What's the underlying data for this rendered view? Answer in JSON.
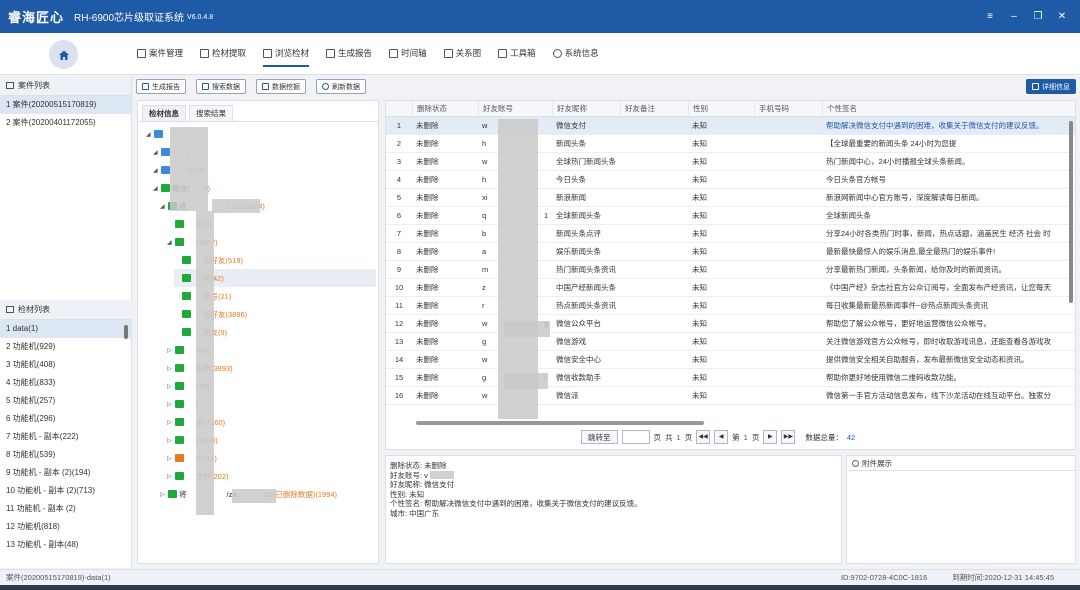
{
  "app": {
    "name": "睿海匠心",
    "title": "RH-6900芯片级取证系统",
    "version": "V6.0.4.8"
  },
  "nav": {
    "items": [
      {
        "label": "案件管理"
      },
      {
        "label": "检材提取"
      },
      {
        "label": "浏览检材"
      },
      {
        "label": "生成报告"
      },
      {
        "label": "时间轴"
      },
      {
        "label": "关系图"
      },
      {
        "label": "工具箱"
      },
      {
        "label": "系统信息"
      }
    ],
    "active": "浏览检材"
  },
  "cases": {
    "title": "案件列表",
    "items": [
      "1  案件(20200515170819)",
      "2  案件(20200401172055)"
    ]
  },
  "detection": {
    "title": "检材列表",
    "items": [
      "1  data(1)",
      "2  功能机(929)",
      "3  功能机(408)",
      "4  功能机(833)",
      "5  功能机(257)",
      "6  功能机(296)",
      "7  功能机 - 副本(222)",
      "8  功能机(539)",
      "9  功能机 - 副本 (2)(194)",
      "10  功能机 - 副本 (2)(713)",
      "11  功能机 - 副本 (2)",
      "12  功能机(818)",
      "13  功能机 - 副本(48)"
    ]
  },
  "toolbar": {
    "buttons": [
      "生成报告",
      "搜索数据",
      "数据挖掘",
      "刷新数据"
    ],
    "detail": "详细信息"
  },
  "tree": {
    "tabs": [
      "检材信息",
      "搜索结果"
    ],
    "rows": [
      {
        "text": "",
        "count": "",
        "indent": 0
      },
      {
        "text": "",
        "count": ")",
        "indent": 1
      },
      {
        "text": "",
        "count": "0018)",
        "indent": 1
      },
      {
        "text": "微信(",
        "count": "8)",
        "indent": 1
      },
      {
        "text": "将",
        "count": "",
        "suffix": "123(18024)",
        "indent": 2
      },
      {
        "text": "",
        "count": "息(1)",
        "indent": 3
      },
      {
        "text": "",
        "count": "(4487)",
        "indent": 3
      },
      {
        "text": "",
        "count": "组好友(519)",
        "indent": 4
      },
      {
        "text": "",
        "count": "号(42)",
        "indent": 4
      },
      {
        "text": "",
        "count": "账号(21)",
        "indent": 4
      },
      {
        "text": "",
        "count": "陌好友(3896)",
        "indent": 4
      },
      {
        "text": "",
        "count": "朋友(9)",
        "indent": 4
      },
      {
        "text": "",
        "count": "(40)",
        "indent": 3
      },
      {
        "text": "",
        "count": "列表(3893)",
        "indent": 3
      },
      {
        "text": "",
        "count": "(40)",
        "indent": 3
      },
      {
        "text": "",
        "count": ")",
        "indent": 3
      },
      {
        "text": "",
        "count": "录(7360)",
        "indent": 3
      },
      {
        "text": "",
        "count": "(1988)",
        "indent": 3
      },
      {
        "text": "",
        "count": "夹(12)",
        "indent": 3
      },
      {
        "text": "",
        "count": "文件(202)",
        "indent": 3
      },
      {
        "text": "将",
        "count": "",
        "suffix": "/za",
        "tail": "23(已删除数据)(1994)",
        "indent": 2
      }
    ]
  },
  "table": {
    "columns": [
      "删除状态",
      "好友账号",
      "好友昵称",
      "好友备注",
      "性别",
      "手机号码",
      "个性签名"
    ],
    "rows": [
      {
        "n": "1",
        "status": "未删除",
        "acct": "w",
        "nick": "微信支付",
        "gender": "未知",
        "sig": "帮助解决微信支付中遇到的困难，收集关于微信支付的建议反馈。"
      },
      {
        "n": "2",
        "status": "未删除",
        "acct": "h",
        "nick": "新闻头条",
        "gender": "未知",
        "sig": "【全球最重要的新闻头条 24小时为您提"
      },
      {
        "n": "3",
        "status": "未删除",
        "acct": "w",
        "nick": "全球热门新闻头条",
        "gender": "未知",
        "sig": "热门新闻中心，24小时播报全球头条新闻。"
      },
      {
        "n": "4",
        "status": "未删除",
        "acct": "h",
        "nick": "今日头条",
        "gender": "未知",
        "sig": "今日头条官方帐号"
      },
      {
        "n": "5",
        "status": "未删除",
        "acct": "xi",
        "nick": "新浪新闻",
        "gender": "未知",
        "sig": "新浪网新闻中心官方账号，深度解读每日新闻。"
      },
      {
        "n": "6",
        "status": "未删除",
        "acct": "q",
        "acct2": "1",
        "nick": "全球新闻头条",
        "gender": "未知",
        "sig": "全球新闻头条"
      },
      {
        "n": "7",
        "status": "未删除",
        "acct": "b",
        "nick": "新闻头条点评",
        "gender": "未知",
        "sig": "分享24小时各类热门时事，新闻，热点话题，涵盖民生 经济 社会 时"
      },
      {
        "n": "8",
        "status": "未删除",
        "acct": "a",
        "nick": "娱乐新闻头条",
        "gender": "未知",
        "sig": "最新最快最惊人的娱乐消息,最全最热门的娱乐事件!"
      },
      {
        "n": "9",
        "status": "未删除",
        "acct": "m",
        "nick": "热门新闻头条资讯",
        "gender": "未知",
        "sig": "分享最新热门新闻，头条新闻，给你及时的新闻资讯。"
      },
      {
        "n": "10",
        "status": "未删除",
        "acct": "z",
        "nick": "中国产经新闻头条",
        "gender": "未知",
        "sig": "《中国产经》杂志社官方公众订阅号，全面发布产经资讯，让您每天"
      },
      {
        "n": "11",
        "status": "未删除",
        "acct": "r",
        "nick": "热点新闻头条资讯",
        "gender": "未知",
        "sig": "每日收集最新最热新闻事件~@热点新闻头条资讯"
      },
      {
        "n": "12",
        "status": "未删除",
        "acct": "w",
        "acct2": "g",
        "nick": "微信公众平台",
        "gender": "未知",
        "sig": "帮助您了解公众帐号，更好地运营微信公众帐号。"
      },
      {
        "n": "13",
        "status": "未删除",
        "acct": "g",
        "nick": "微信游戏",
        "gender": "未知",
        "sig": "关注微信游戏官方公众帐号，即时收取游戏讯息，还能查看各游戏攻"
      },
      {
        "n": "14",
        "status": "未删除",
        "acct": "w",
        "nick": "微信安全中心",
        "gender": "未知",
        "sig": "提供微信安全相关自助服务，发布最新微信安全动态和资讯。"
      },
      {
        "n": "15",
        "status": "未删除",
        "acct": "g",
        "acct2": "c",
        "nick": "微信收款助手",
        "gender": "未知",
        "sig": "帮助你更好地使用微信二维码收款功能。"
      },
      {
        "n": "16",
        "status": "未删除",
        "acct": "w",
        "nick": "微信派",
        "gender": "未知",
        "sig": "微信第一手官方活动信息发布，线下沙龙活动在线互动平台。独家分"
      }
    ]
  },
  "pager": {
    "goto": "跳转至",
    "page_unit": "页",
    "total_pre": "共",
    "total_pages": "1",
    "page_unit2": "页",
    "current_pre": "第",
    "current": "1",
    "current_unit": "页",
    "total_label": "数据总量：",
    "total": "42"
  },
  "detail": {
    "lines": [
      "删除状态: 未删除",
      "好友账号: v",
      "好友昵称: 微信支付",
      "性别: 未知",
      "个性签名: 帮助解决微信支付中遇到的困难，收集关于微信支付的建议反馈。",
      "城市: 中国广东"
    ]
  },
  "attach": {
    "title": "附件展示"
  },
  "status": {
    "left": "案件(20200515170819)-data(1)",
    "id": "ID:9702-0728-4C0C-1816",
    "expire": "到期时间:2020-12-31 14:45:45"
  },
  "colors": {
    "brand": "#1f5aa6",
    "highlight": "#e07b22",
    "wechat": "#22a83a"
  }
}
